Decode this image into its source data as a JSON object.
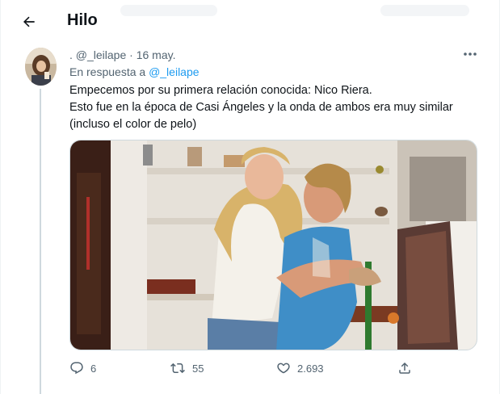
{
  "header": {
    "title": "Hilo",
    "back_icon": "arrow-left-icon"
  },
  "tweet": {
    "author_handle": ". @_leilape",
    "separator": "·",
    "date": "16 may.",
    "reply_prefix": "En respuesta a",
    "reply_mention": "@_leilape",
    "text_lines": [
      "Empecemos por su primera relación conocida: Nico Riera.",
      "Esto fue en la época de Casi Ángeles y la onda de ambos era muy similar",
      "(incluso el color de pelo)"
    ],
    "more_icon": "more-dots-icon"
  },
  "actions": {
    "replies": "6",
    "retweets": "55",
    "likes": "2.693",
    "reply_icon": "reply-icon",
    "retweet_icon": "retweet-icon",
    "like_icon": "heart-icon",
    "share_icon": "share-icon"
  },
  "colors": {
    "text_primary": "#0f1419",
    "text_secondary": "#536471",
    "accent": "#1d9bf0",
    "border": "#cfd9de"
  }
}
